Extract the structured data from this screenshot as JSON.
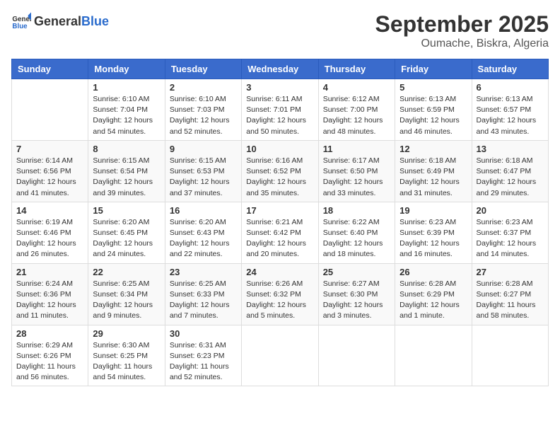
{
  "header": {
    "logo_general": "General",
    "logo_blue": "Blue",
    "month": "September 2025",
    "location": "Oumache, Biskra, Algeria"
  },
  "weekdays": [
    "Sunday",
    "Monday",
    "Tuesday",
    "Wednesday",
    "Thursday",
    "Friday",
    "Saturday"
  ],
  "weeks": [
    [
      {
        "day": "",
        "info": ""
      },
      {
        "day": "1",
        "info": "Sunrise: 6:10 AM\nSunset: 7:04 PM\nDaylight: 12 hours\nand 54 minutes."
      },
      {
        "day": "2",
        "info": "Sunrise: 6:10 AM\nSunset: 7:03 PM\nDaylight: 12 hours\nand 52 minutes."
      },
      {
        "day": "3",
        "info": "Sunrise: 6:11 AM\nSunset: 7:01 PM\nDaylight: 12 hours\nand 50 minutes."
      },
      {
        "day": "4",
        "info": "Sunrise: 6:12 AM\nSunset: 7:00 PM\nDaylight: 12 hours\nand 48 minutes."
      },
      {
        "day": "5",
        "info": "Sunrise: 6:13 AM\nSunset: 6:59 PM\nDaylight: 12 hours\nand 46 minutes."
      },
      {
        "day": "6",
        "info": "Sunrise: 6:13 AM\nSunset: 6:57 PM\nDaylight: 12 hours\nand 43 minutes."
      }
    ],
    [
      {
        "day": "7",
        "info": "Sunrise: 6:14 AM\nSunset: 6:56 PM\nDaylight: 12 hours\nand 41 minutes."
      },
      {
        "day": "8",
        "info": "Sunrise: 6:15 AM\nSunset: 6:54 PM\nDaylight: 12 hours\nand 39 minutes."
      },
      {
        "day": "9",
        "info": "Sunrise: 6:15 AM\nSunset: 6:53 PM\nDaylight: 12 hours\nand 37 minutes."
      },
      {
        "day": "10",
        "info": "Sunrise: 6:16 AM\nSunset: 6:52 PM\nDaylight: 12 hours\nand 35 minutes."
      },
      {
        "day": "11",
        "info": "Sunrise: 6:17 AM\nSunset: 6:50 PM\nDaylight: 12 hours\nand 33 minutes."
      },
      {
        "day": "12",
        "info": "Sunrise: 6:18 AM\nSunset: 6:49 PM\nDaylight: 12 hours\nand 31 minutes."
      },
      {
        "day": "13",
        "info": "Sunrise: 6:18 AM\nSunset: 6:47 PM\nDaylight: 12 hours\nand 29 minutes."
      }
    ],
    [
      {
        "day": "14",
        "info": "Sunrise: 6:19 AM\nSunset: 6:46 PM\nDaylight: 12 hours\nand 26 minutes."
      },
      {
        "day": "15",
        "info": "Sunrise: 6:20 AM\nSunset: 6:45 PM\nDaylight: 12 hours\nand 24 minutes."
      },
      {
        "day": "16",
        "info": "Sunrise: 6:20 AM\nSunset: 6:43 PM\nDaylight: 12 hours\nand 22 minutes."
      },
      {
        "day": "17",
        "info": "Sunrise: 6:21 AM\nSunset: 6:42 PM\nDaylight: 12 hours\nand 20 minutes."
      },
      {
        "day": "18",
        "info": "Sunrise: 6:22 AM\nSunset: 6:40 PM\nDaylight: 12 hours\nand 18 minutes."
      },
      {
        "day": "19",
        "info": "Sunrise: 6:23 AM\nSunset: 6:39 PM\nDaylight: 12 hours\nand 16 minutes."
      },
      {
        "day": "20",
        "info": "Sunrise: 6:23 AM\nSunset: 6:37 PM\nDaylight: 12 hours\nand 14 minutes."
      }
    ],
    [
      {
        "day": "21",
        "info": "Sunrise: 6:24 AM\nSunset: 6:36 PM\nDaylight: 12 hours\nand 11 minutes."
      },
      {
        "day": "22",
        "info": "Sunrise: 6:25 AM\nSunset: 6:34 PM\nDaylight: 12 hours\nand 9 minutes."
      },
      {
        "day": "23",
        "info": "Sunrise: 6:25 AM\nSunset: 6:33 PM\nDaylight: 12 hours\nand 7 minutes."
      },
      {
        "day": "24",
        "info": "Sunrise: 6:26 AM\nSunset: 6:32 PM\nDaylight: 12 hours\nand 5 minutes."
      },
      {
        "day": "25",
        "info": "Sunrise: 6:27 AM\nSunset: 6:30 PM\nDaylight: 12 hours\nand 3 minutes."
      },
      {
        "day": "26",
        "info": "Sunrise: 6:28 AM\nSunset: 6:29 PM\nDaylight: 12 hours\nand 1 minute."
      },
      {
        "day": "27",
        "info": "Sunrise: 6:28 AM\nSunset: 6:27 PM\nDaylight: 11 hours\nand 58 minutes."
      }
    ],
    [
      {
        "day": "28",
        "info": "Sunrise: 6:29 AM\nSunset: 6:26 PM\nDaylight: 11 hours\nand 56 minutes."
      },
      {
        "day": "29",
        "info": "Sunrise: 6:30 AM\nSunset: 6:25 PM\nDaylight: 11 hours\nand 54 minutes."
      },
      {
        "day": "30",
        "info": "Sunrise: 6:31 AM\nSunset: 6:23 PM\nDaylight: 11 hours\nand 52 minutes."
      },
      {
        "day": "",
        "info": ""
      },
      {
        "day": "",
        "info": ""
      },
      {
        "day": "",
        "info": ""
      },
      {
        "day": "",
        "info": ""
      }
    ]
  ]
}
